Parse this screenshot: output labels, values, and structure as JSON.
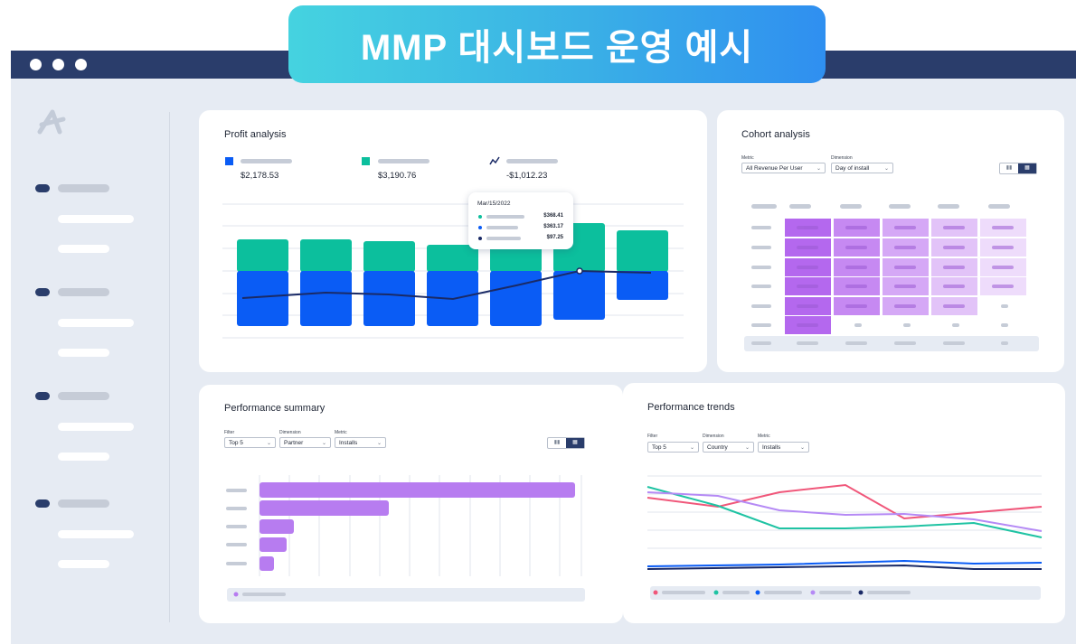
{
  "banner": {
    "title": "MMP 대시보드 운영 예시"
  },
  "colors": {
    "green": "#0cbf9d",
    "blue": "#0a5cf5",
    "navy": "#1a2a66",
    "purple": "#b77cf0",
    "pink": "#f0577a",
    "teal": "#1fc3a3",
    "lavender": "#b58af5"
  },
  "profit": {
    "title": "Profit analysis",
    "legend": [
      {
        "icon": "blue-square-icon",
        "value": "$2,178.53"
      },
      {
        "icon": "green-square-icon",
        "value": "$3,190.76"
      },
      {
        "icon": "trend-line-icon",
        "value": "-$1,012.23"
      }
    ],
    "tooltip": {
      "date": "Mar/15/2022",
      "values": [
        "$368.41",
        "$363.17",
        "$97.25"
      ]
    }
  },
  "cohort": {
    "title": "Cohort analysis",
    "metric_label": "Metric",
    "metric_value": "All Revenue Per User",
    "dimension_label": "Dimension",
    "dimension_value": "Day of install"
  },
  "summary": {
    "title": "Performance summary",
    "filter_label": "Filter",
    "filter_value": "Top 5",
    "dimension_label": "Dimension",
    "dimension_value": "Partner",
    "metric_label": "Metric",
    "metric_value": "Installs"
  },
  "trends": {
    "title": "Performance trends",
    "filter_label": "Filter",
    "filter_value": "Top 5",
    "dimension_label": "Dimension",
    "dimension_value": "Country",
    "metric_label": "Metric",
    "metric_value": "Installs"
  }
}
